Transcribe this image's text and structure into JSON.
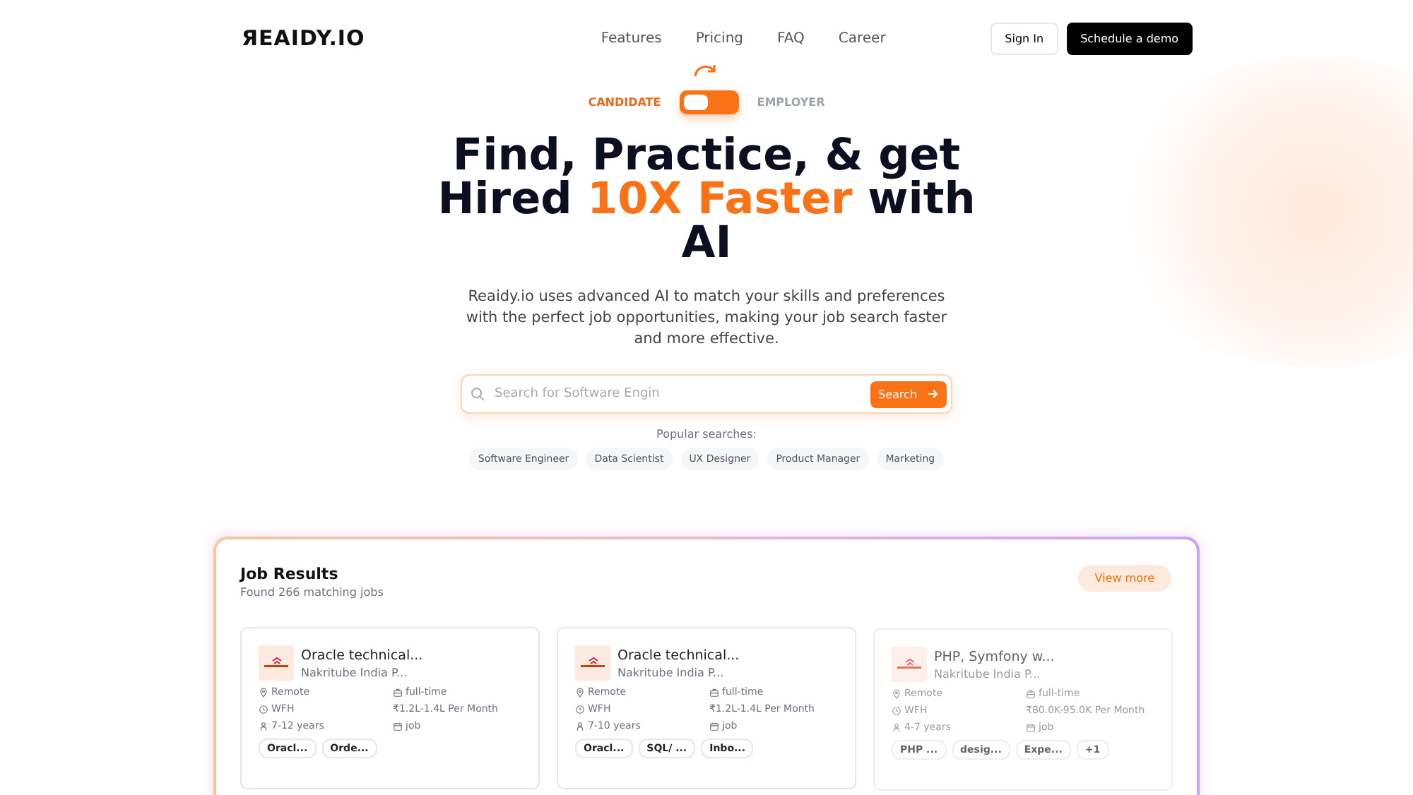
{
  "logo": "ЯEAIDY.IO",
  "nav": [
    "Features",
    "Pricing",
    "FAQ",
    "Career"
  ],
  "actions": {
    "sign_in": "Sign In",
    "demo": "Schedule a demo"
  },
  "toggle": {
    "left": "CANDIDATE",
    "right": "EMPLOYER",
    "on": false
  },
  "heading": {
    "before": "Find, Practice, & get Hired ",
    "highlight": "10X Faster",
    "after": " with AI"
  },
  "intro": "Reaidy.io uses advanced AI to match your skills and preferences with the perfect job opportunities, making your job search faster and more effective.",
  "search": {
    "placeholder": "Search for Software Engin",
    "button": "Search"
  },
  "popular": {
    "label": "Popular searches:",
    "items": [
      "Software Engineer",
      "Data Scientist",
      "UX Designer",
      "Product Manager",
      "Marketing"
    ]
  },
  "results": {
    "title": "Job Results",
    "count": "Found 266 matching jobs",
    "view_more": "View more",
    "jobs": [
      {
        "title": "Oracle technical...",
        "company": "Nakritube India P...",
        "location": "Remote",
        "type": "full-time",
        "mode": "WFH",
        "salary": "₹1.2L-1.4L Per Month",
        "experience": "7-12 years",
        "category": "job",
        "tags": [
          "Oracl...",
          "Orde..."
        ],
        "faded": false
      },
      {
        "title": "Oracle technical...",
        "company": "Nakritube India P...",
        "location": "Remote",
        "type": "full-time",
        "mode": "WFH",
        "salary": "₹1.2L-1.4L Per Month",
        "experience": "7-10 years",
        "category": "job",
        "tags": [
          "Oracl...",
          "SQL/ ...",
          "Inbo..."
        ],
        "faded": false
      },
      {
        "title": "PHP, Symfony w...",
        "company": "Nakritube India P...",
        "location": "Remote",
        "type": "full-time",
        "mode": "WFH",
        "salary": "₹80.0K-95.0K Per Month",
        "experience": "4-7 years",
        "category": "job",
        "tags": [
          "PHP ...",
          "desig...",
          "Expe...",
          "+1"
        ],
        "faded": true
      }
    ]
  }
}
